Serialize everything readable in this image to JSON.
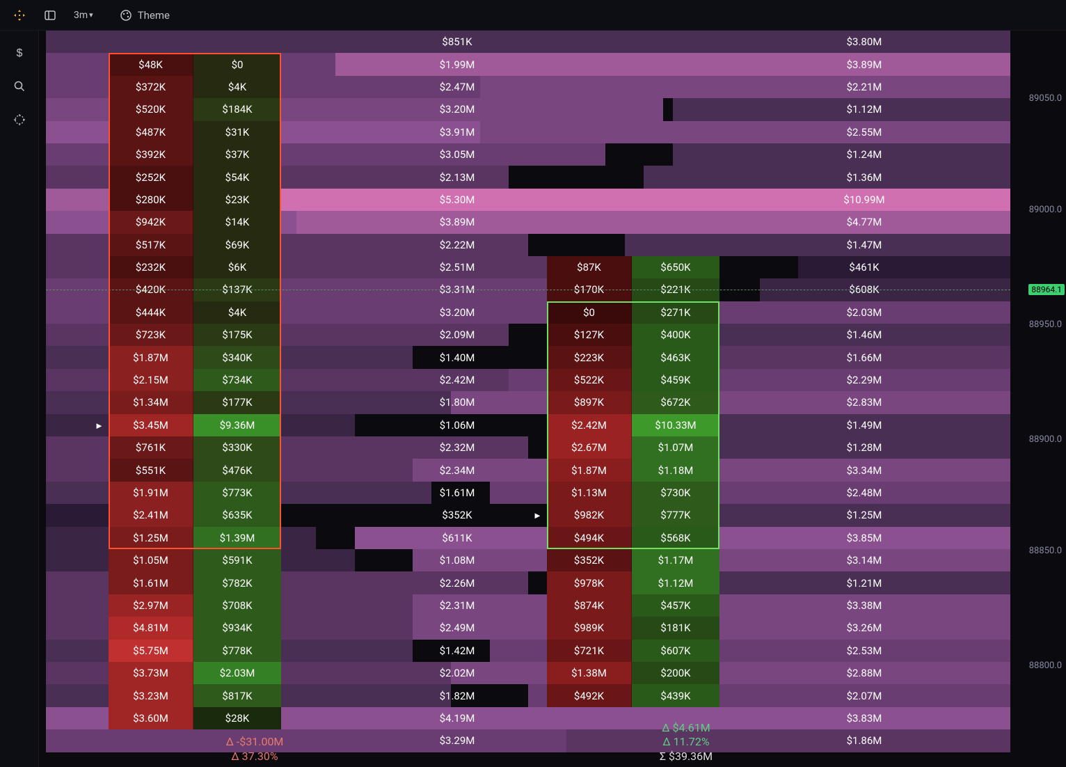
{
  "toolbar": {
    "timeframe": "3m",
    "theme_label": "Theme"
  },
  "axis": {
    "ticks": [
      "89050.0",
      "89000.0",
      "88950.0",
      "88900.0",
      "88850.0",
      "88800.0"
    ],
    "current": "88964.1"
  },
  "footer_left": {
    "delta_abs": "Δ -$31.00M",
    "delta_pct": "Δ 37.30%"
  },
  "footer_right": {
    "delta_abs": "Δ $4.61M",
    "delta_pct": "Δ 11.72%",
    "sigma": "Σ $39.36M"
  },
  "dashed_row": 11,
  "play_markers": [
    {
      "row": 17,
      "col": 0
    },
    {
      "row": 21,
      "col": 1
    }
  ],
  "red_border": {
    "start": 1,
    "end": 22
  },
  "green_border": {
    "start": 12,
    "end": 22
  },
  "rows": [
    {
      "bgL": "#4a2f55",
      "bgLw": 58,
      "bgR": "#4a2f55",
      "bgRw": 45,
      "mid": "$851K",
      "right": "$3.80M"
    },
    {
      "bgL": "#6a3d72",
      "bgLw": 53,
      "bgR": "#a05a9a",
      "bgRw": 70,
      "red": "$48K",
      "redC": "#4a1010",
      "green": "$0",
      "greenC": "#262a10",
      "mid": "$1.99M",
      "right": "$3.89M"
    },
    {
      "bgL": "#6a3d72",
      "bgLw": 55,
      "bgR": "#7a4680",
      "bgRw": 55,
      "red": "$372K",
      "redC": "#5a1414",
      "green": "$4K",
      "greenC": "#262a10",
      "mid": "$2.47M",
      "right": "$2.21M"
    },
    {
      "bgL": "#7a4680",
      "bgLw": 64,
      "bgR": "#4a2f55",
      "bgRw": 35,
      "red": "$520K",
      "redC": "#5a1414",
      "green": "$184K",
      "greenC": "#2a3a14",
      "mid": "$3.20M",
      "right": "$1.12M"
    },
    {
      "bgL": "#8a5090",
      "bgLw": 68,
      "bgR": "#7a4680",
      "bgRw": 55,
      "red": "$487K",
      "redC": "#5a1414",
      "green": "$31K",
      "greenC": "#262a10",
      "mid": "$3.91M",
      "right": "$2.55M"
    },
    {
      "bgL": "#6a3d72",
      "bgLw": 58,
      "bgR": "#4a2f55",
      "bgRw": 35,
      "red": "$392K",
      "redC": "#5a1414",
      "green": "$37K",
      "greenC": "#262a10",
      "mid": "$3.05M",
      "right": "$1.24M"
    },
    {
      "bgL": "#5a3562",
      "bgLw": 48,
      "bgR": "#4a2f55",
      "bgRw": 38,
      "red": "$252K",
      "redC": "#4a1010",
      "green": "$54K",
      "greenC": "#262a10",
      "mid": "$2.13M",
      "right": "$1.36M"
    },
    {
      "bgL": "#a05a9a",
      "bgLw": 78,
      "bgR": "#d070b0",
      "bgRw": 92,
      "red": "$280K",
      "redC": "#4a1010",
      "green": "$23K",
      "greenC": "#262a10",
      "mid": "$5.30M",
      "right": "$10.99M"
    },
    {
      "bgL": "#8a5090",
      "bgLw": 68,
      "bgR": "#a05a9a",
      "bgRw": 74,
      "red": "$942K",
      "redC": "#6a1818",
      "green": "$14K",
      "greenC": "#262a10",
      "mid": "$3.89M",
      "right": "$4.77M"
    },
    {
      "bgL": "#5a3562",
      "bgLw": 50,
      "bgR": "#4a2f55",
      "bgRw": 40,
      "red": "$517K",
      "redC": "#5a1414",
      "green": "$69K",
      "greenC": "#262a10",
      "mid": "$2.22M",
      "right": "$1.47M"
    },
    {
      "bgL": "#5a3562",
      "bgLw": 52,
      "bgR": "#2a1a35",
      "bgRw": 22,
      "red": "$232K",
      "redC": "#4a1010",
      "green": "$6K",
      "greenC": "#262a10",
      "mid": "$2.51M",
      "red2": "$87K",
      "red2C": "#4a0e0e",
      "green2": "$650K",
      "green2C": "#2a5a1a",
      "right": "$461K"
    },
    {
      "bgL": "#6a3d72",
      "bgLw": 60,
      "bgR": "#3a2545",
      "bgRw": 26,
      "red": "$420K",
      "redC": "#5a1414",
      "green": "$137K",
      "greenC": "#2a3a14",
      "mid": "$3.31M",
      "red2": "$170K",
      "red2C": "#4a0e0e",
      "green2": "$221K",
      "green2C": "#264a16",
      "right": "$608K"
    },
    {
      "bgL": "#6a3d72",
      "bgLw": 60,
      "bgR": "#6a3d72",
      "bgRw": 50,
      "red": "$444K",
      "redC": "#5a1414",
      "green": "$4K",
      "greenC": "#262a10",
      "mid": "$3.20M",
      "red2": "$0",
      "red2C": "#3a0a0a",
      "green2": "$271K",
      "green2C": "#264a16",
      "right": "$2.03M"
    },
    {
      "bgL": "#5a3562",
      "bgLw": 48,
      "bgR": "#4a2f55",
      "bgRw": 40,
      "red": "$723K",
      "redC": "#6a1818",
      "green": "$175K",
      "greenC": "#2a3a14",
      "mid": "$2.09M",
      "red2": "$127K",
      "red2C": "#4a0e0e",
      "green2": "$400K",
      "green2C": "#2a5a1a",
      "right": "$1.46M"
    },
    {
      "bgL": "#4a2f55",
      "bgLw": 38,
      "bgR": "#5a3562",
      "bgRw": 44,
      "red": "$1.87M",
      "redC": "#8a2020",
      "green": "$340K",
      "greenC": "#2e4a18",
      "mid": "$1.40M",
      "red2": "$223K",
      "red2C": "#5a1212",
      "green2": "$463K",
      "green2C": "#2a5a1a",
      "right": "$1.66M"
    },
    {
      "bgL": "#5a3562",
      "bgLw": 52,
      "bgR": "#6a3d72",
      "bgRw": 52,
      "red": "$2.15M",
      "redC": "#8a2020",
      "green": "$734K",
      "greenC": "#2e5a1c",
      "mid": "$2.42M",
      "red2": "$522K",
      "red2C": "#6a1616",
      "green2": "$459K",
      "green2C": "#2a5a1a",
      "right": "$2.29M"
    },
    {
      "bgL": "#4a2f55",
      "bgLw": 42,
      "bgR": "#7a4680",
      "bgRw": 58,
      "red": "$1.34M",
      "redC": "#7a1c1c",
      "green": "$177K",
      "greenC": "#2a3a14",
      "mid": "$1.80M",
      "red2": "$897K",
      "red2C": "#7a1a1a",
      "green2": "$672K",
      "green2C": "#2e5a1c",
      "right": "$2.83M"
    },
    {
      "bgL": "#3a2545",
      "bgLw": 32,
      "bgR": "#4a2f55",
      "bgRw": 40,
      "red": "$3.45M",
      "redC": "#a02626",
      "green": "$9.36M",
      "greenC": "#3a9028",
      "mid": "$1.06M",
      "red2": "$2.42M",
      "red2C": "#9a2222",
      "green2": "$10.33M",
      "green2C": "#3d9a2a",
      "right": "$1.49M"
    },
    {
      "bgL": "#5a3562",
      "bgLw": 50,
      "bgR": "#4a2f55",
      "bgRw": 36,
      "red": "$761K",
      "redC": "#6a1818",
      "green": "$330K",
      "greenC": "#2e4a18",
      "mid": "$2.32M",
      "red2": "$2.67M",
      "red2C": "#9a2222",
      "green2": "$1.07M",
      "green2C": "#307020",
      "right": "$1.28M"
    },
    {
      "bgL": "#5a3562",
      "bgLw": 50,
      "bgR": "#7a4680",
      "bgRw": 62,
      "red": "$551K",
      "redC": "#5a1414",
      "green": "$476K",
      "greenC": "#2e4a18",
      "mid": "$2.34M",
      "red2": "$1.87M",
      "red2C": "#8a1e1e",
      "green2": "$1.18M",
      "green2C": "#307020",
      "right": "$3.34M"
    },
    {
      "bgL": "#4a2f55",
      "bgLw": 40,
      "bgR": "#6a3d72",
      "bgRw": 54,
      "red": "$1.91M",
      "redC": "#8a2020",
      "green": "$773K",
      "greenC": "#2e5a1c",
      "mid": "$1.61M",
      "red2": "$1.13M",
      "red2C": "#7a1a1a",
      "green2": "$730K",
      "green2C": "#2e5a1c",
      "right": "$2.48M"
    },
    {
      "bgL": "#2a1a35",
      "bgLw": 20,
      "bgR": "#4a2f55",
      "bgRw": 36,
      "red": "$2.41M",
      "redC": "#8a2020",
      "green": "$635K",
      "greenC": "#2e5a1c",
      "mid": "$352K",
      "red2": "$982K",
      "red2C": "#7a1a1a",
      "green2": "$777K",
      "green2C": "#2e5a1c",
      "right": "$1.25M"
    },
    {
      "bgL": "#3a2545",
      "bgLw": 28,
      "bgR": "#8a5090",
      "bgRw": 68,
      "red": "$1.25M",
      "redC": "#7a1c1c",
      "green": "$1.39M",
      "greenC": "#307020",
      "mid": "$611K",
      "red2": "$494K",
      "red2C": "#6a1616",
      "green2": "$568K",
      "green2C": "#2a5a1a",
      "right": "$3.85M"
    },
    {
      "bgL": "#3a2545",
      "bgLw": 32,
      "bgR": "#7a4680",
      "bgRw": 62,
      "red": "$1.05M",
      "redC": "#7a1c1c",
      "green": "$591K",
      "greenC": "#2e5a1c",
      "mid": "$1.08M",
      "red2": "$352K",
      "red2C": "#5a1212",
      "green2": "$1.17M",
      "green2C": "#307020",
      "right": "$3.14M"
    },
    {
      "bgL": "#5a3562",
      "bgLw": 50,
      "bgR": "#4a2f55",
      "bgRw": 36,
      "red": "$1.61M",
      "redC": "#7a1c1c",
      "green": "$782K",
      "greenC": "#2e5a1c",
      "mid": "$2.26M",
      "red2": "$978K",
      "red2C": "#7a1a1a",
      "green2": "$1.12M",
      "green2C": "#307020",
      "right": "$1.21M"
    },
    {
      "bgL": "#5a3562",
      "bgLw": 50,
      "bgR": "#7a4680",
      "bgRw": 62,
      "red": "$2.97M",
      "redC": "#9a2424",
      "green": "$708K",
      "greenC": "#2e5a1c",
      "mid": "$2.31M",
      "red2": "$874K",
      "red2C": "#7a1a1a",
      "green2": "$457K",
      "green2C": "#2a5a1a",
      "right": "$3.38M"
    },
    {
      "bgL": "#5a3562",
      "bgLw": 52,
      "bgR": "#7a4680",
      "bgRw": 62,
      "red": "$4.81M",
      "redC": "#b02a2a",
      "green": "$934K",
      "greenC": "#2e5a1c",
      "mid": "$2.49M",
      "red2": "$989K",
      "red2C": "#7a1a1a",
      "green2": "$181K",
      "green2C": "#264a16",
      "right": "$3.26M"
    },
    {
      "bgL": "#4a2f55",
      "bgLw": 38,
      "bgR": "#6a3d72",
      "bgRw": 54,
      "red": "$5.75M",
      "redC": "#c03030",
      "green": "$778K",
      "greenC": "#2e5a1c",
      "mid": "$1.42M",
      "red2": "$721K",
      "red2C": "#6a1616",
      "green2": "$607K",
      "green2C": "#2a5a1a",
      "right": "$2.53M"
    },
    {
      "bgL": "#5a3562",
      "bgLw": 46,
      "bgR": "#7a4680",
      "bgRw": 58,
      "red": "$3.73M",
      "redC": "#a02626",
      "green": "$2.03M",
      "greenC": "#348024",
      "mid": "$2.02M",
      "red2": "$1.38M",
      "red2C": "#8a1e1e",
      "green2": "$200K",
      "green2C": "#264a16",
      "right": "$2.88M"
    },
    {
      "bgL": "#4a2f55",
      "bgLw": 42,
      "bgR": "#6a3d72",
      "bgRw": 50,
      "red": "$3.23M",
      "redC": "#a02626",
      "green": "$817K",
      "greenC": "#2e5a1c",
      "mid": "$1.82M",
      "red2": "$492K",
      "red2C": "#6a1616",
      "green2": "$439K",
      "green2C": "#2a5a1a",
      "right": "$2.07M"
    },
    {
      "bgL": "#8a5090",
      "bgLw": 70,
      "bgR": "#8a5090",
      "bgRw": 68,
      "red": "$3.60M",
      "redC": "#a02626",
      "green": "$28K",
      "greenC": "#1a2a0c",
      "mid": "$4.19M",
      "right": "$3.83M"
    },
    {
      "bgL": "#6a3d72",
      "bgLw": 60,
      "bgR": "#5a3562",
      "bgRw": 46,
      "mid": "$3.29M",
      "right": "$1.86M"
    }
  ]
}
